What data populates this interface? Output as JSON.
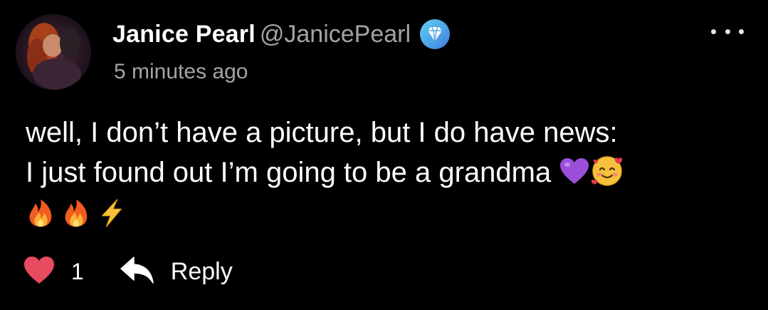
{
  "post": {
    "author": {
      "display_name": "Janice Pearl",
      "handle": "@JanicePearl",
      "badge_icon": "diamond-verified-icon",
      "avatar_icon": "user-avatar"
    },
    "timestamp": "5 minutes ago",
    "more_icon": "more-horizontal-icon",
    "body": {
      "line1": "well, I don’t have a picture, but I do have news:",
      "line2": "I just found out I’m going to be a grandma",
      "line2_emojis": [
        "purple-heart-emoji",
        "smiling-face-with-hearts-emoji"
      ],
      "line3_emojis": [
        "fire-emoji",
        "fire-emoji",
        "lightning-emoji"
      ]
    },
    "actions": {
      "like_icon": "heart-icon",
      "like_count": "1",
      "reply_icon": "reply-arrow-icon",
      "reply_label": "Reply"
    },
    "colors": {
      "background": "#000000",
      "text": "#ffffff",
      "muted": "#a3a3a8",
      "heart": "#e84a5f",
      "badge": "#4fa8e8"
    }
  }
}
